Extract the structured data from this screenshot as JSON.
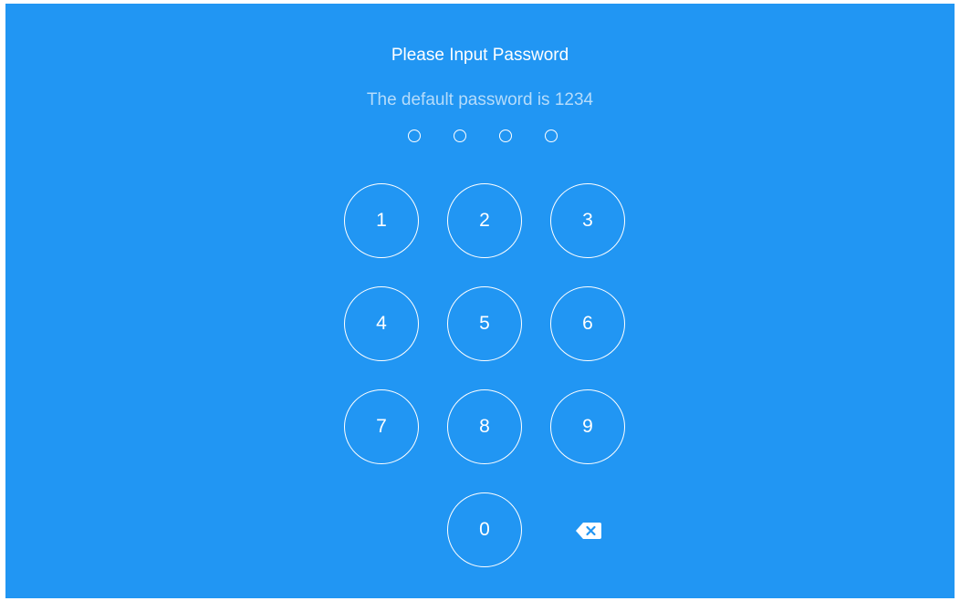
{
  "prompt": {
    "title": "Please Input Password",
    "hint": "The default password is 1234"
  },
  "pin": {
    "length": 4,
    "filled": 0
  },
  "keypad": {
    "keys": [
      "1",
      "2",
      "3",
      "4",
      "5",
      "6",
      "7",
      "8",
      "9",
      "0"
    ],
    "backspace_icon": "backspace-icon"
  },
  "colors": {
    "background": "#2196F3",
    "foreground": "#FFFFFF",
    "hint": "#B5DCFB"
  }
}
